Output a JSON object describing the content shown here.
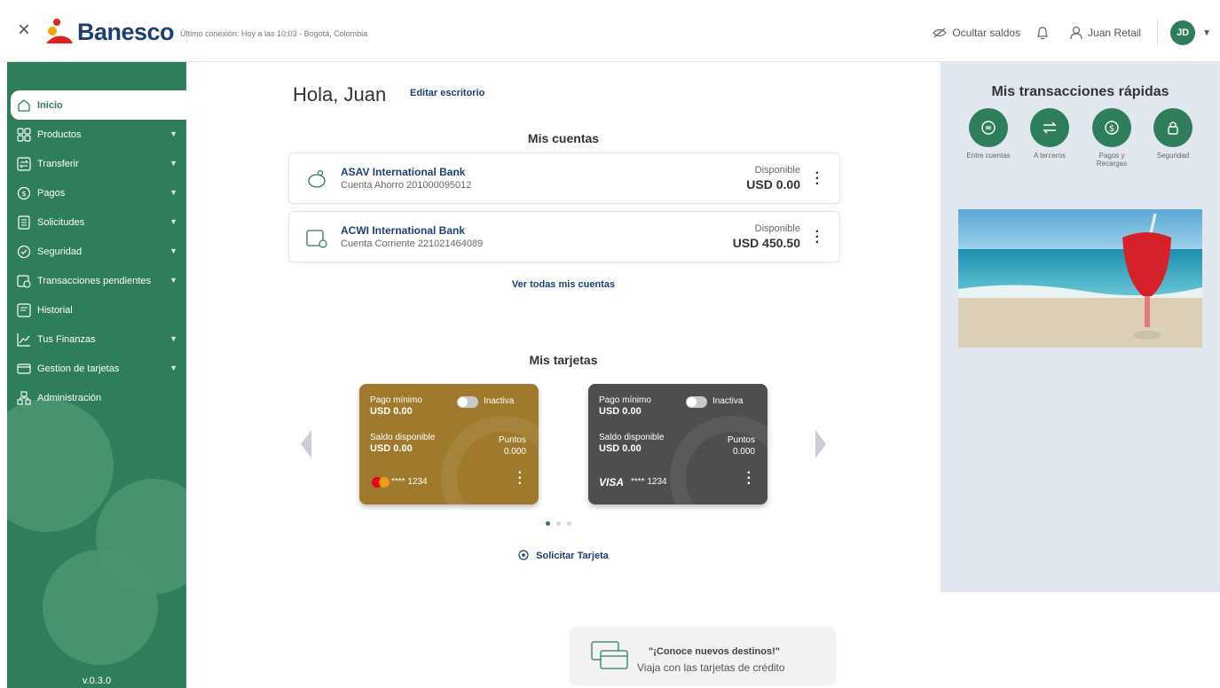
{
  "header": {
    "brand": "Banesco",
    "last_login": "Último conexión: Hoy a las 10:03 - Bogotá, Colombia",
    "hide_balances": "Ocultar saldos",
    "user_name": "Juan Retail",
    "avatar_initials": "JD"
  },
  "sidebar": {
    "items": [
      {
        "label": "Inicio",
        "icon": "home-icon",
        "active": true
      },
      {
        "label": "Productos",
        "icon": "grid-icon"
      },
      {
        "label": "Transferir",
        "icon": "transfer-icon"
      },
      {
        "label": "Pagos",
        "icon": "coin-icon"
      },
      {
        "label": "Solicitudes",
        "icon": "document-icon"
      },
      {
        "label": "Seguridad",
        "icon": "shield-icon"
      },
      {
        "label": "Transacciones pendientes",
        "icon": "calendar-clock-icon"
      },
      {
        "label": "Historial",
        "icon": "history-icon"
      },
      {
        "label": "Tus Finanzas",
        "icon": "chart-line-icon"
      },
      {
        "label": "Gestion de tarjetas",
        "icon": "card-icon"
      },
      {
        "label": "Administración",
        "icon": "org-icon"
      }
    ],
    "version": "v.0.3.0"
  },
  "main": {
    "greeting": "Hola, Juan",
    "edit_desktop": "Editar escritorio",
    "accounts_title": "Mis cuentas",
    "accounts": [
      {
        "name": "ASAV International Bank",
        "number": "Cuenta Ahorro 201000095012",
        "label": "Disponible",
        "balance": "USD 0.00"
      },
      {
        "name": "ACWI International Bank",
        "number": "Cuenta Corriente 221021464089",
        "label": "Disponible",
        "balance": "USD 450.50"
      }
    ],
    "see_all": "Ver todas mis cuentas",
    "cards_title": "Mis tarjetas",
    "cards": [
      {
        "min_label": "Pago mínimo",
        "min_value": "USD 0.00",
        "status": "Inactiva",
        "avail_label": "Saldo disponible",
        "avail_value": "USD 0.00",
        "points_label": "Puntos",
        "points_value": "0.000",
        "number": "**** 1234",
        "brand": "mastercard",
        "color": "#a07a2c"
      },
      {
        "min_label": "Pago mínimo",
        "min_value": "USD 0.00",
        "status": "Inactiva",
        "avail_label": "Saldo disponible",
        "avail_value": "USD 0.00",
        "points_label": "Puntos",
        "points_value": "0.000",
        "number": "**** 1234",
        "brand": "VISA",
        "color": "#4e4e4e"
      }
    ],
    "request_card": "Solicitar Tarjeta"
  },
  "quick": {
    "title": "Mis transacciones rápidas",
    "items": [
      {
        "label": "Entre cuentas",
        "icon": "exchange-circle-icon"
      },
      {
        "label": "A terceros",
        "icon": "arrows-icon"
      },
      {
        "label": "Pagos y Recargas",
        "icon": "coin-icon"
      },
      {
        "label": "Seguridad",
        "icon": "lock-icon"
      }
    ]
  },
  "promo": {
    "title": "\"¡Conoce nuevos destinos!\"",
    "subtitle": "Viaja con las tarjetas de crédito"
  },
  "colors": {
    "brand_green": "#2e7d5b",
    "brand_blue": "#1c3f75",
    "panel": "#e1e7ee"
  }
}
